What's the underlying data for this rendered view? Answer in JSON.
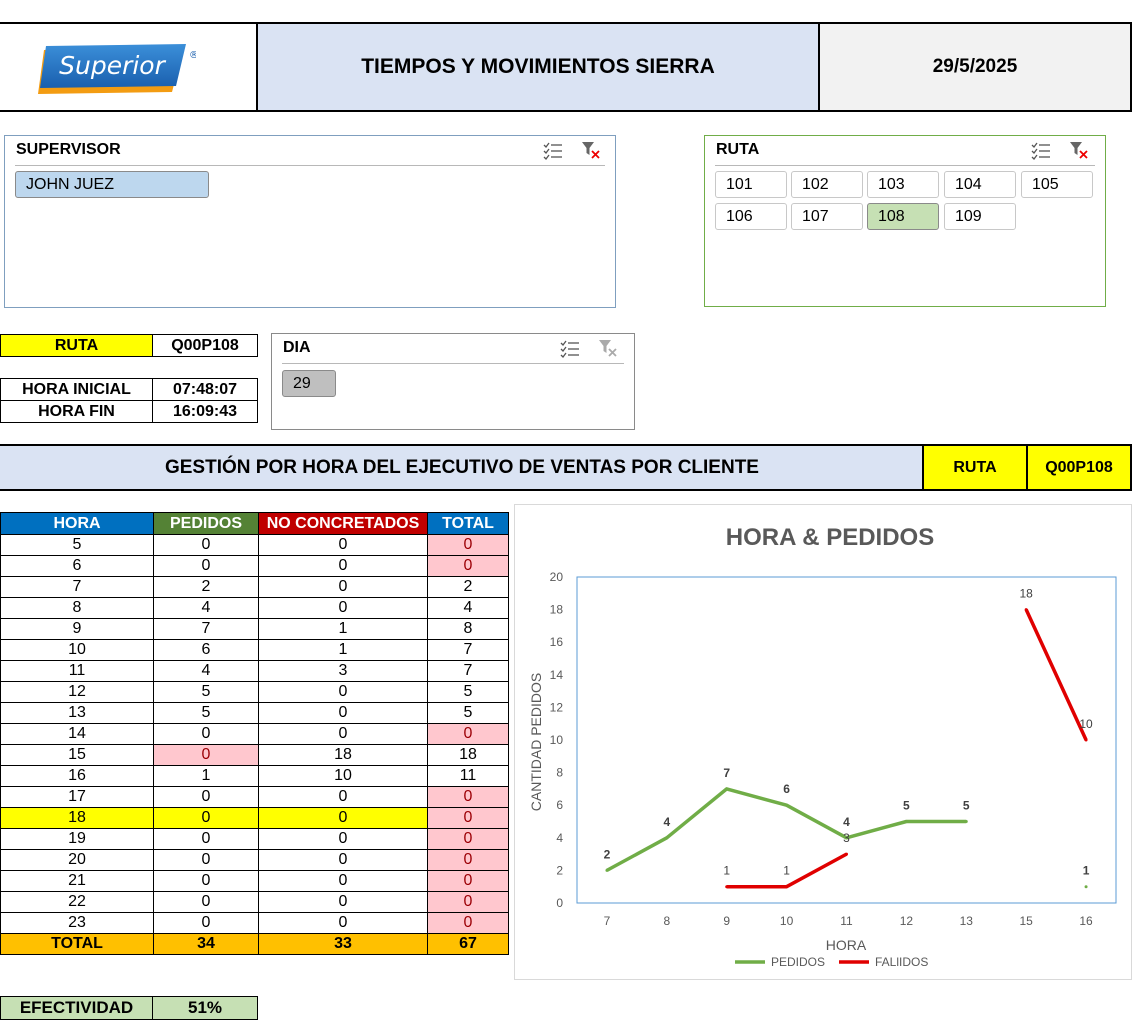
{
  "header": {
    "logo_text": "Superior",
    "logo_reg": "®",
    "title": "TIEMPOS Y MOVIMIENTOS SIERRA",
    "date": "29/5/2025"
  },
  "colors": {
    "header_fill": "#dae3f3",
    "date_fill": "#f2f2f2",
    "yellow": "#ffff00",
    "blue_header": "#0070c0",
    "green_header": "#548235",
    "red_header": "#c00000",
    "total_orange": "#ffc000",
    "pink": "#ffc7ce",
    "selected_blue": "#bdd7ee",
    "selected_green": "#c6e0b4",
    "efectividad_green": "#c6e0b4"
  },
  "slicers": {
    "supervisor": {
      "title": "SUPERVISOR",
      "items": [
        "JOHN JUEZ"
      ],
      "selected": "JOHN JUEZ"
    },
    "ruta": {
      "title": "RUTA",
      "items": [
        "101",
        "102",
        "103",
        "104",
        "105",
        "106",
        "107",
        "108",
        "109"
      ],
      "selected": "108"
    },
    "dia": {
      "title": "DIA",
      "items": [
        "29"
      ],
      "selected": "29"
    },
    "icons": [
      "multiselect-icon",
      "clear-filter-icon"
    ]
  },
  "info": {
    "ruta_label": "RUTA",
    "ruta_value": "Q00P108",
    "hora_inicial_label": "HORA INICIAL",
    "hora_inicial_value": "07:48:07",
    "hora_fin_label": "HORA FIN",
    "hora_fin_value": "16:09:43"
  },
  "section": {
    "title": "GESTIÓN POR HORA DEL EJECUTIVO DE VENTAS POR CLIENTE",
    "ruta_label": "RUTA",
    "ruta_value": "Q00P108"
  },
  "table": {
    "headers": [
      "HORA",
      "PEDIDOS",
      "NO CONCRETADOS",
      "TOTAL"
    ],
    "rows": [
      [
        "5",
        "0",
        "0",
        "0"
      ],
      [
        "6",
        "0",
        "0",
        "0"
      ],
      [
        "7",
        "2",
        "0",
        "2"
      ],
      [
        "8",
        "4",
        "0",
        "4"
      ],
      [
        "9",
        "7",
        "1",
        "8"
      ],
      [
        "10",
        "6",
        "1",
        "7"
      ],
      [
        "11",
        "4",
        "3",
        "7"
      ],
      [
        "12",
        "5",
        "0",
        "5"
      ],
      [
        "13",
        "5",
        "0",
        "5"
      ],
      [
        "14",
        "0",
        "0",
        "0"
      ],
      [
        "15",
        "0",
        "18",
        "18"
      ],
      [
        "16",
        "1",
        "10",
        "11"
      ],
      [
        "17",
        "0",
        "0",
        "0"
      ],
      [
        "18",
        "0",
        "0",
        "0"
      ],
      [
        "19",
        "0",
        "0",
        "0"
      ],
      [
        "20",
        "0",
        "0",
        "0"
      ],
      [
        "21",
        "0",
        "0",
        "0"
      ],
      [
        "22",
        "0",
        "0",
        "0"
      ],
      [
        "23",
        "0",
        "0",
        "0"
      ]
    ],
    "total": [
      "TOTAL",
      "34",
      "33",
      "67"
    ]
  },
  "efectividad": {
    "label": "EFECTIVIDAD",
    "value": "51%"
  },
  "chart_data": {
    "type": "line",
    "title": "HORA  & PEDIDOS",
    "xlabel": "HORA",
    "ylabel": "CANTIDAD PEDIDOS",
    "categories": [
      "7",
      "8",
      "9",
      "10",
      "11",
      "12",
      "13",
      "15",
      "16"
    ],
    "ylim": [
      0,
      20
    ],
    "yticks": [
      0,
      2,
      4,
      6,
      8,
      10,
      12,
      14,
      16,
      18,
      20
    ],
    "grid": false,
    "legend_position": "bottom",
    "series": [
      {
        "name": "PEDIDOS",
        "color": "#70ad47",
        "values": [
          2,
          4,
          7,
          6,
          4,
          5,
          5,
          null,
          1
        ]
      },
      {
        "name": "FALlIDOS",
        "color": "#e00000",
        "values": [
          null,
          null,
          1,
          1,
          3,
          null,
          null,
          18,
          10
        ]
      }
    ]
  }
}
